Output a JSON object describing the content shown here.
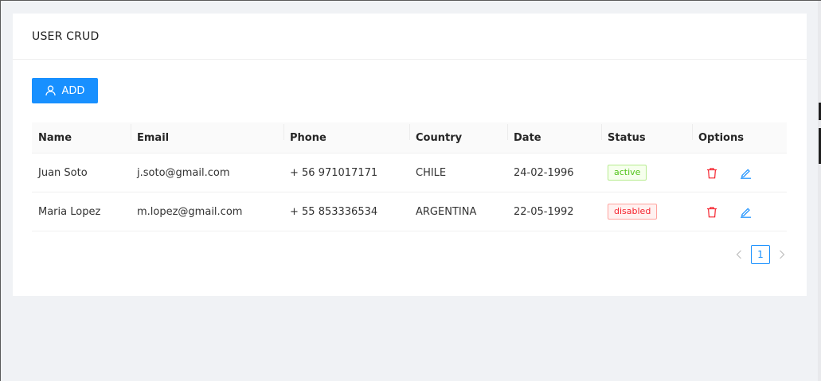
{
  "card": {
    "title": "USER CRUD"
  },
  "toolbar": {
    "add_label": "ADD",
    "add_icon": "user-icon"
  },
  "table": {
    "columns": [
      "Name",
      "Email",
      "Phone",
      "Country",
      "Date",
      "Status",
      "Options"
    ],
    "rows": [
      {
        "name": "Juan Soto",
        "email": "j.soto@gmail.com",
        "phone": "+ 56 971017171",
        "country": "CHILE",
        "date": "24-02-1996",
        "status": "active"
      },
      {
        "name": "Maria Lopez",
        "email": "m.lopez@gmail.com",
        "phone": "+ 55 853336534",
        "country": "ARGENTINA",
        "date": "22-05-1992",
        "status": "disabled"
      }
    ],
    "option_icons": [
      "trash-icon",
      "edit-icon"
    ]
  },
  "pagination": {
    "current_page": "1"
  },
  "colors": {
    "primary": "#1890ff",
    "danger": "#f5222d",
    "success": "#52c41a",
    "background": "#f0f2f5"
  }
}
